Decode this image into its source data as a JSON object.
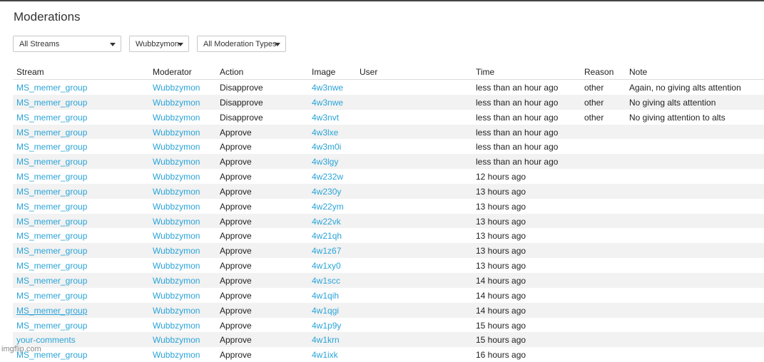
{
  "page": {
    "title": "Moderations",
    "watermark": "imgflip.com"
  },
  "filters": {
    "stream": "All Streams",
    "moderator": "Wubbzymon",
    "type": "All Moderation Types"
  },
  "table": {
    "headers": [
      "Stream",
      "Moderator",
      "Action",
      "Image",
      "User",
      "Time",
      "Reason",
      "Note"
    ],
    "rows": [
      [
        "MS_memer_group",
        "Wubbzymon",
        "Disapprove",
        "4w3nwe",
        "",
        "less than an hour ago",
        "other",
        "Again, no giving alts attention"
      ],
      [
        "MS_memer_group",
        "Wubbzymon",
        "Disapprove",
        "4w3nwe",
        "",
        "less than an hour ago",
        "other",
        "No giving alts attention"
      ],
      [
        "MS_memer_group",
        "Wubbzymon",
        "Disapprove",
        "4w3nvt",
        "",
        "less than an hour ago",
        "other",
        "No giving attention to alts"
      ],
      [
        "MS_memer_group",
        "Wubbzymon",
        "Approve",
        "4w3lxe",
        "",
        "less than an hour ago",
        "",
        ""
      ],
      [
        "MS_memer_group",
        "Wubbzymon",
        "Approve",
        "4w3m0i",
        "",
        "less than an hour ago",
        "",
        ""
      ],
      [
        "MS_memer_group",
        "Wubbzymon",
        "Approve",
        "4w3lgy",
        "",
        "less than an hour ago",
        "",
        ""
      ],
      [
        "MS_memer_group",
        "Wubbzymon",
        "Approve",
        "4w232w",
        "",
        "12 hours ago",
        "",
        ""
      ],
      [
        "MS_memer_group",
        "Wubbzymon",
        "Approve",
        "4w230y",
        "",
        "13 hours ago",
        "",
        ""
      ],
      [
        "MS_memer_group",
        "Wubbzymon",
        "Approve",
        "4w22ym",
        "",
        "13 hours ago",
        "",
        ""
      ],
      [
        "MS_memer_group",
        "Wubbzymon",
        "Approve",
        "4w22vk",
        "",
        "13 hours ago",
        "",
        ""
      ],
      [
        "MS_memer_group",
        "Wubbzymon",
        "Approve",
        "4w21qh",
        "",
        "13 hours ago",
        "",
        ""
      ],
      [
        "MS_memer_group",
        "Wubbzymon",
        "Approve",
        "4w1z67",
        "",
        "13 hours ago",
        "",
        ""
      ],
      [
        "MS_memer_group",
        "Wubbzymon",
        "Approve",
        "4w1xy0",
        "",
        "13 hours ago",
        "",
        ""
      ],
      [
        "MS_memer_group",
        "Wubbzymon",
        "Approve",
        "4w1scc",
        "",
        "14 hours ago",
        "",
        ""
      ],
      [
        "MS_memer_group",
        "Wubbzymon",
        "Approve",
        "4w1qih",
        "",
        "14 hours ago",
        "",
        ""
      ],
      [
        "MS_memer_group",
        "Wubbzymon",
        "Approve",
        "4w1qgi",
        "",
        "14 hours ago",
        "",
        ""
      ],
      [
        "MS_memer_group",
        "Wubbzymon",
        "Approve",
        "4w1p9y",
        "",
        "15 hours ago",
        "",
        ""
      ],
      [
        "your-comments",
        "Wubbzymon",
        "Approve",
        "4w1krn",
        "",
        "15 hours ago",
        "",
        ""
      ],
      [
        "MS_memer_group",
        "Wubbzymon",
        "Approve",
        "4w1ixk",
        "",
        "16 hours ago",
        "",
        ""
      ]
    ]
  },
  "colors": {
    "link": "#2aa4d8",
    "stripe": "#f2f2f2",
    "text": "#222222"
  }
}
